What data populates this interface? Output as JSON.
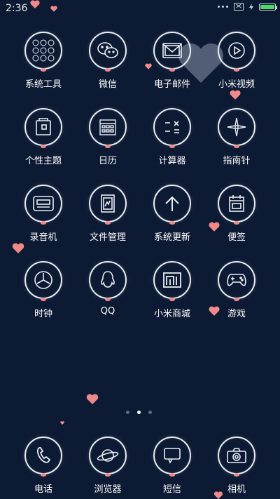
{
  "status": {
    "time": "2:36"
  },
  "apps": [
    {
      "label": "系统工具",
      "icon": "grid-icon"
    },
    {
      "label": "微信",
      "icon": "wechat-icon"
    },
    {
      "label": "电子邮件",
      "icon": "mail-icon"
    },
    {
      "label": "小米视频",
      "icon": "play-icon"
    },
    {
      "label": "个性主题",
      "icon": "theme-icon"
    },
    {
      "label": "日历",
      "icon": "calendar-icon"
    },
    {
      "label": "计算器",
      "icon": "calculator-icon"
    },
    {
      "label": "指南针",
      "icon": "compass-icon"
    },
    {
      "label": "录音机",
      "icon": "recorder-icon"
    },
    {
      "label": "文件管理",
      "icon": "file-icon"
    },
    {
      "label": "系统更新",
      "icon": "arrow-up-icon"
    },
    {
      "label": "便签",
      "icon": "notes-icon"
    },
    {
      "label": "时钟",
      "icon": "clock-icon"
    },
    {
      "label": "QQ",
      "icon": "qq-icon"
    },
    {
      "label": "小米商城",
      "icon": "mi-store-icon"
    },
    {
      "label": "游戏",
      "icon": "gamepad-icon"
    }
  ],
  "dock": [
    {
      "label": "电话",
      "icon": "phone-icon"
    },
    {
      "label": "浏览器",
      "icon": "planet-icon"
    },
    {
      "label": "短信",
      "icon": "message-icon"
    },
    {
      "label": "相机",
      "icon": "camera-icon"
    }
  ],
  "colors": {
    "background": "#0c1a33",
    "accent": "#f08a8a",
    "battery": "#4cd964"
  }
}
